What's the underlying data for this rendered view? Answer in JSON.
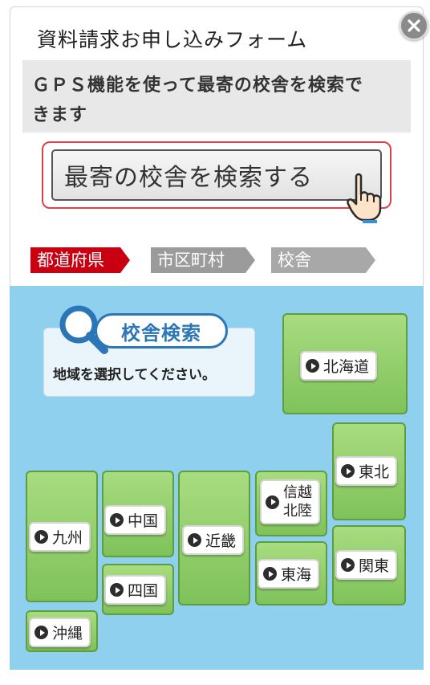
{
  "form": {
    "title": "資料請求お申し込みフォーム",
    "gps_line1": "ＧＰＳ機能を使って最寄の校舎を検索で",
    "gps_line2": "きます",
    "search_button": "最寄の校舎を検索する"
  },
  "steps": [
    {
      "label": "都道府県",
      "active": true
    },
    {
      "label": "市区町村",
      "active": false
    },
    {
      "label": "校舎",
      "active": false
    }
  ],
  "map": {
    "header": "校舎検索",
    "instruction": "地域を選択してください。",
    "regions": {
      "hokkaido": "北海道",
      "tohoku": "東北",
      "shinetsu_line1": "信越",
      "shinetsu_line2": "北陸",
      "kanto": "関東",
      "tokai": "東海",
      "kinki": "近畿",
      "chugoku": "中国",
      "shikoku": "四国",
      "kyushu": "九州",
      "okinawa": "沖縄"
    }
  },
  "colors": {
    "accent_red": "#c90012",
    "map_blue": "#8ed0ee",
    "region_green": "#7fc25a",
    "header_blue": "#2b76b6"
  },
  "icons": [
    "close-icon",
    "pointing-hand-icon",
    "magnifier-icon",
    "play-bullet-icon"
  ]
}
